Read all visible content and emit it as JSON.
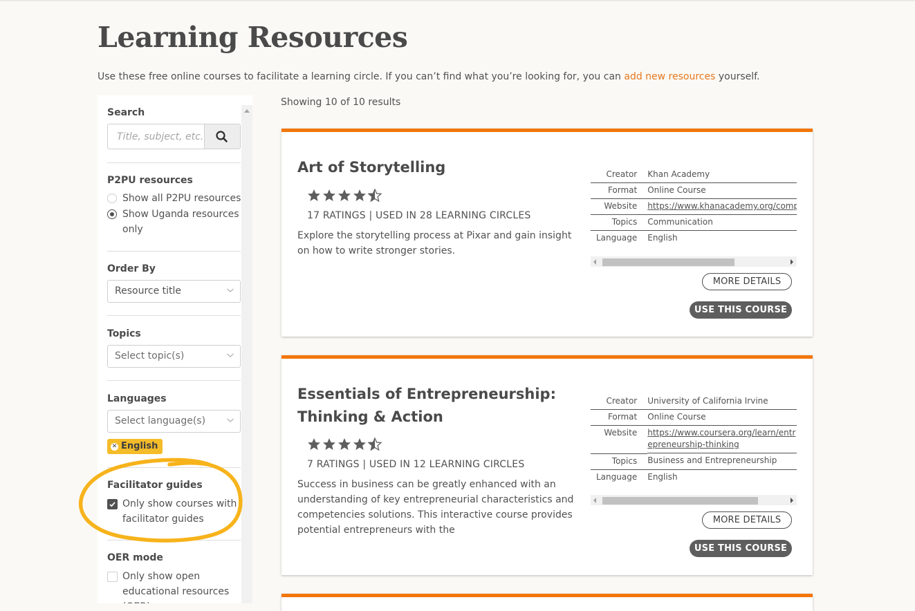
{
  "page": {
    "title": "Learning Resources",
    "intro_before_link": "Use these free online courses to facilitate a learning circle. If you can’t find what you’re looking for, you can ",
    "intro_link": "add new resources",
    "intro_after_link": " yourself."
  },
  "filters": {
    "search": {
      "label": "Search",
      "placeholder": "Title, subject, etc."
    },
    "p2pu": {
      "label": "P2PU resources",
      "options": [
        {
          "label": "Show all P2PU resources",
          "selected": false
        },
        {
          "label": "Show Uganda resources only",
          "selected": true
        }
      ]
    },
    "order_by": {
      "label": "Order By",
      "value": "Resource title"
    },
    "topics": {
      "label": "Topics",
      "placeholder": "Select topic(s)"
    },
    "languages": {
      "label": "Languages",
      "placeholder": "Select language(s)",
      "selected_tags": [
        "English"
      ]
    },
    "facilitator_guides": {
      "label": "Facilitator guides",
      "option": "Only show courses with facilitator guides",
      "checked": true
    },
    "oer_mode": {
      "label": "OER mode",
      "option": "Only show open educational resources (OER)",
      "checked": false
    }
  },
  "results": {
    "count_text": "Showing 10 of 10 results",
    "cards": [
      {
        "title": "Art of Storytelling",
        "rating": 4.5,
        "ratings_text": "17 RATINGS | USED IN 28 LEARNING CIRCLES",
        "description": "Explore the storytelling process at Pixar and gain insight on how to write stronger stories.",
        "meta": [
          {
            "key": "Creator",
            "value": "Khan Academy"
          },
          {
            "key": "Format",
            "value": "Online Course"
          },
          {
            "key": "Website",
            "value": "https://www.khanacademy.org/computing/pixar/storytelling"
          },
          {
            "key": "Topics",
            "value": "Communication"
          },
          {
            "key": "Language",
            "value": "English"
          }
        ],
        "more_details_label": "MORE DETAILS",
        "use_course_label": "USE THIS COURSE"
      },
      {
        "title": "Essentials of Entrepreneurship: Thinking & Action",
        "rating": 4.5,
        "ratings_text": "7 RATINGS | USED IN 12 LEARNING CIRCLES",
        "description": "Success in business can be greatly enhanced with an understanding of key entrepreneurial characteristics and competencies solutions. This interactive course provides potential entrepreneurs with the",
        "meta": [
          {
            "key": "Creator",
            "value": "University of California Irvine"
          },
          {
            "key": "Format",
            "value": "Online Course"
          },
          {
            "key": "Website",
            "value": "https://www.coursera.org/learn/entrepreneurship-thinking"
          },
          {
            "key": "Topics",
            "value": "Business and Entrepreneurship"
          },
          {
            "key": "Language",
            "value": "English"
          }
        ],
        "more_details_label": "MORE DETAILS",
        "use_course_label": "USE THIS COURSE"
      }
    ]
  },
  "colors": {
    "accent_orange": "#f2760a",
    "link_orange": "#e8781e",
    "tag_yellow": "#f5bc2a",
    "annotation_yellow": "#f7b31b",
    "button_dark": "#5e5e5e"
  }
}
